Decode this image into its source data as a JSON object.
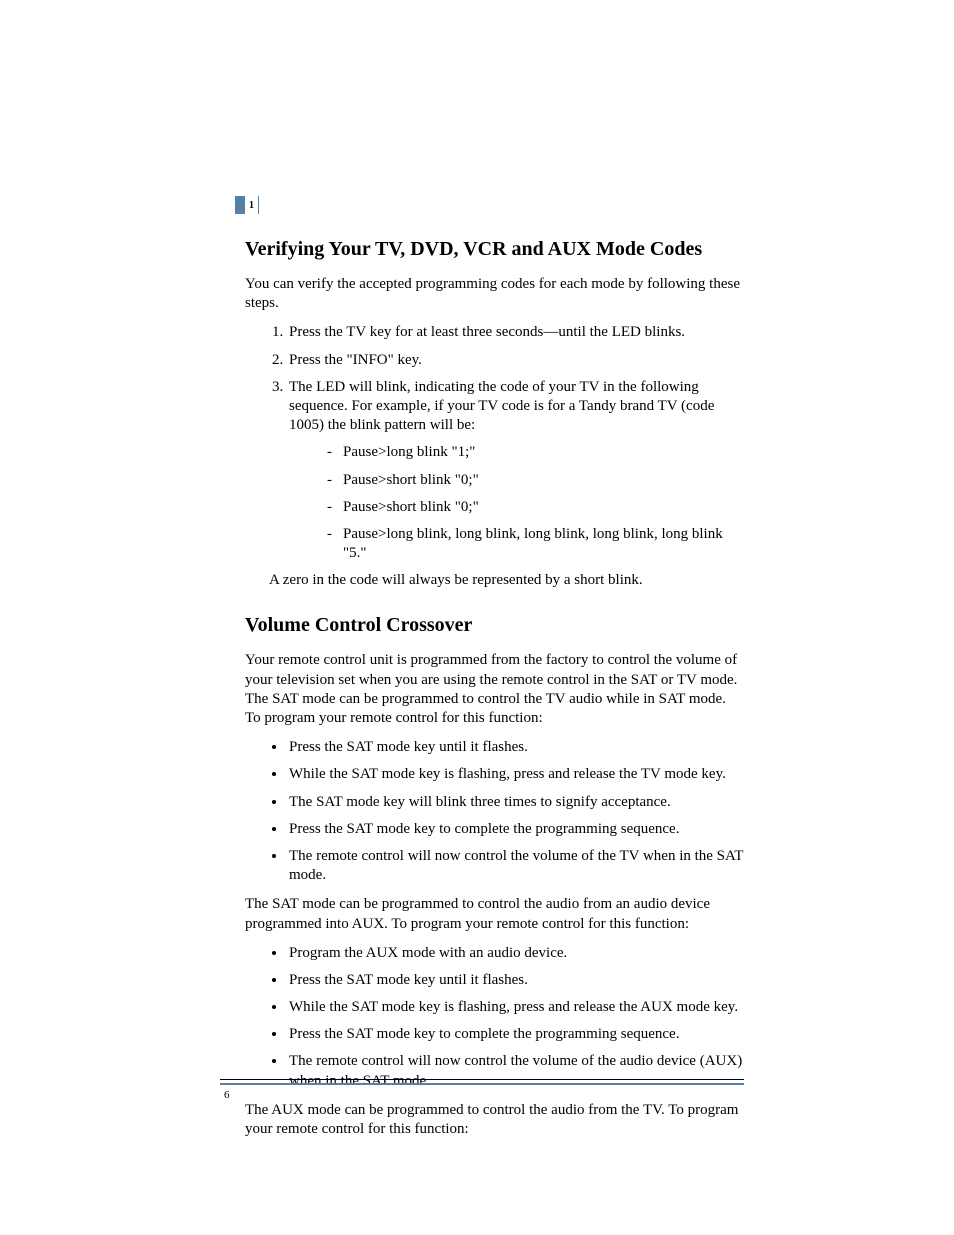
{
  "chapter_number": "1",
  "page_number": "6",
  "section1": {
    "heading": "Verifying Your TV, DVD, VCR and AUX Mode Codes",
    "intro": "You can verify the accepted programming codes for each mode by following these steps.",
    "steps": {
      "s1": "Press the TV key for at least three seconds—until the LED blinks.",
      "s2": "Press the \"INFO\" key.",
      "s3": "The LED will blink, indicating the code of your TV in the following sequence. For example, if your TV code is for a Tandy brand TV (code 1005) the blink pattern will be:"
    },
    "sub": {
      "a": "Pause>long blink \"1;\"",
      "b": "Pause>short blink \"0;\"",
      "c": "Pause>short blink \"0;\"",
      "d": "Pause>long blink, long blink, long blink, long blink, long blink \"5.\""
    },
    "tail": "A zero in the code will always be represented by a short blink."
  },
  "section2": {
    "heading": "Volume Control Crossover",
    "p1": "Your remote control unit is programmed from the factory to control the volume of your television set when you are using the remote control in the SAT or TV mode. The SAT mode can be programmed to control the TV audio while in SAT mode. To program your remote control for this function:",
    "list1": {
      "a": "Press the SAT mode key until it flashes.",
      "b": "While the SAT mode key is flashing, press and release the TV mode key.",
      "c": "The SAT mode key will blink three times to signify acceptance.",
      "d": "Press the SAT mode key to complete the programming sequence.",
      "e": "The remote control will now control the volume of the TV when in the SAT mode."
    },
    "p2": "The SAT mode can be programmed to control the audio from an audio device programmed into AUX. To program your remote control for this function:",
    "list2": {
      "a": "Program the AUX mode with an audio device.",
      "b": "Press the SAT mode key until it flashes.",
      "c": "While the SAT mode key is flashing, press and release the AUX mode key.",
      "d": "Press the SAT mode key to complete the programming sequence.",
      "e": "The remote control will now control the volume of the audio device (AUX) when in the SAT mode."
    },
    "p3": "The AUX mode can be programmed to control the audio from the TV. To program your remote control for this function:"
  }
}
